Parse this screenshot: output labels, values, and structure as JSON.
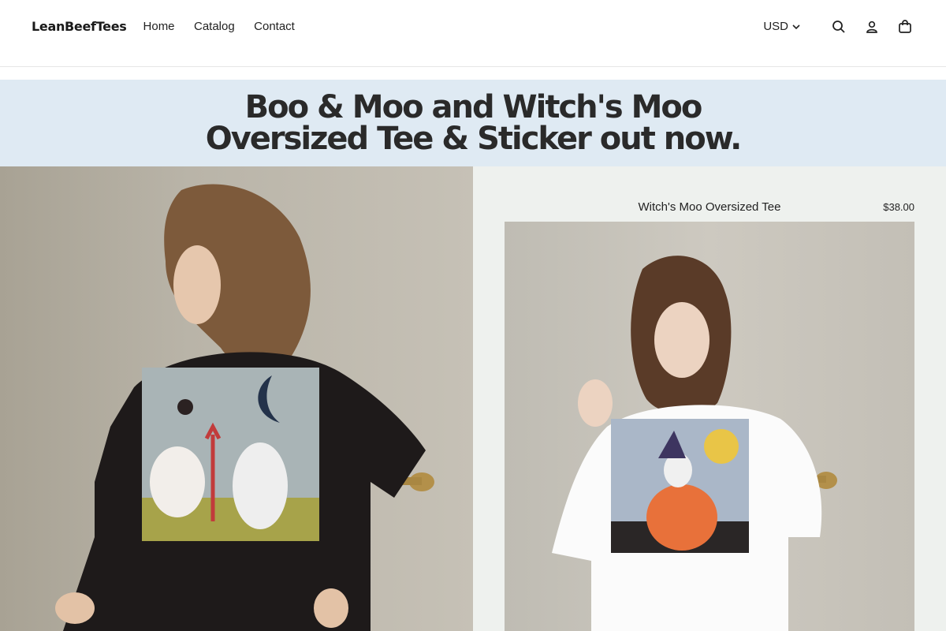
{
  "header": {
    "brand": "LeanBeefTees",
    "nav": [
      "Home",
      "Catalog",
      "Contact"
    ],
    "currency": "USD",
    "icons": [
      "search-icon",
      "account-icon",
      "cart-icon"
    ]
  },
  "banner": {
    "text": "Boo & Moo and Witch's Moo Oversized Tee & Sticker out now."
  },
  "featured_product": {
    "title": "Witch's Moo Oversized Tee",
    "price": "$38.00"
  },
  "colors": {
    "banner_bg": "#dfeaf3",
    "panel_bg": "#eef1ee"
  }
}
